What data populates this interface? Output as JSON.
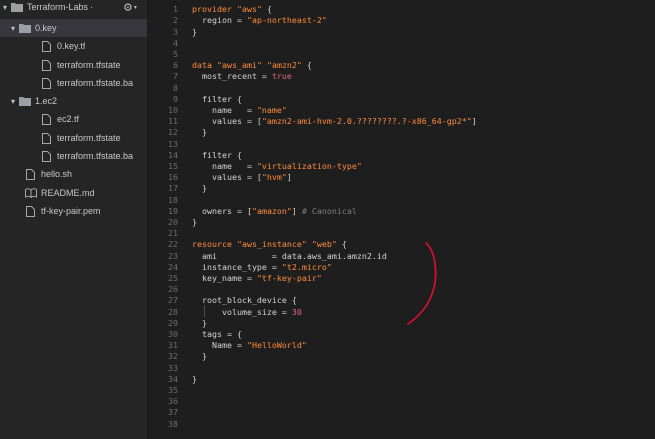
{
  "sidebar": {
    "project": "Terraform-Labs",
    "project_suffix": "·",
    "items": [
      {
        "label": "0.key",
        "type": "folder",
        "expanded": true
      },
      {
        "label": "0.key.tf",
        "type": "file"
      },
      {
        "label": "terraform.tfstate",
        "type": "file"
      },
      {
        "label": "terraform.tfstate.ba",
        "type": "file"
      },
      {
        "label": "1.ec2",
        "type": "folder",
        "expanded": true
      },
      {
        "label": "ec2.tf",
        "type": "file"
      },
      {
        "label": "terraform.tfstate",
        "type": "file"
      },
      {
        "label": "terraform.tfstate.ba",
        "type": "file"
      },
      {
        "label": "hello.sh",
        "type": "file"
      },
      {
        "label": "README.md",
        "type": "file"
      },
      {
        "label": "tf-key-pair.pem",
        "type": "file"
      }
    ]
  },
  "editor": {
    "line_numbers": [
      "1",
      "2",
      "3",
      "4",
      "5",
      "6",
      "7",
      "8",
      "9",
      "10",
      "11",
      "12",
      "13",
      "14",
      "15",
      "16",
      "17",
      "18",
      "19",
      "20",
      "21",
      "22",
      "23",
      "24",
      "25",
      "26",
      "27",
      "28",
      "29",
      "30",
      "31",
      "32",
      "33",
      "34",
      "35",
      "36",
      "37",
      "38"
    ],
    "tokens": {
      "l1": [
        "provider",
        " ",
        "\"aws\"",
        " {"
      ],
      "l2": [
        "  region = ",
        "\"ap-northeast-2\""
      ],
      "l3": [
        "}"
      ],
      "l6": [
        "data",
        " ",
        "\"aws_ami\"",
        " ",
        "\"amzn2\"",
        " {"
      ],
      "l7": [
        "  most_recent = ",
        "true"
      ],
      "l9": [
        "  filter {"
      ],
      "l10": [
        "    name   = ",
        "\"name\""
      ],
      "l11": [
        "    values = [",
        "\"amzn2-ami-hvm-2.0.????????.?-x86_64-gp2*\"",
        "]"
      ],
      "l12": [
        "  }"
      ],
      "l14": [
        "  filter {"
      ],
      "l15": [
        "    name   = ",
        "\"virtualization-type\""
      ],
      "l16": [
        "    values = [",
        "\"hvm\"",
        "]"
      ],
      "l17": [
        "  }"
      ],
      "l19": [
        "  owners = [",
        "\"amazon\"",
        "] ",
        "# Canonical"
      ],
      "l20": [
        "}"
      ],
      "l22": [
        "resource",
        " ",
        "\"aws_instance\"",
        " ",
        "\"web\"",
        " {"
      ],
      "l23": [
        "  ami           = data.aws_ami.amzn2.id"
      ],
      "l24": [
        "  instance_type = ",
        "\"t2.micro\""
      ],
      "l25": [
        "  key_name = ",
        "\"tf-key-pair\""
      ],
      "l27": [
        "  root_block_device {"
      ],
      "l28": [
        "      volume_size = ",
        "30"
      ],
      "l29": [
        "  }"
      ],
      "l30": [
        "  tags = {"
      ],
      "l31": [
        "    Name = ",
        "\"HelloWorld\""
      ],
      "l32": [
        "  }"
      ],
      "l34": [
        "}"
      ]
    }
  },
  "colors": {
    "keyword": "#ff8c3b",
    "string": "#ff8c3b",
    "number": "#e06c75",
    "comment": "#7e7e7e",
    "annotation": "#e0102a"
  }
}
